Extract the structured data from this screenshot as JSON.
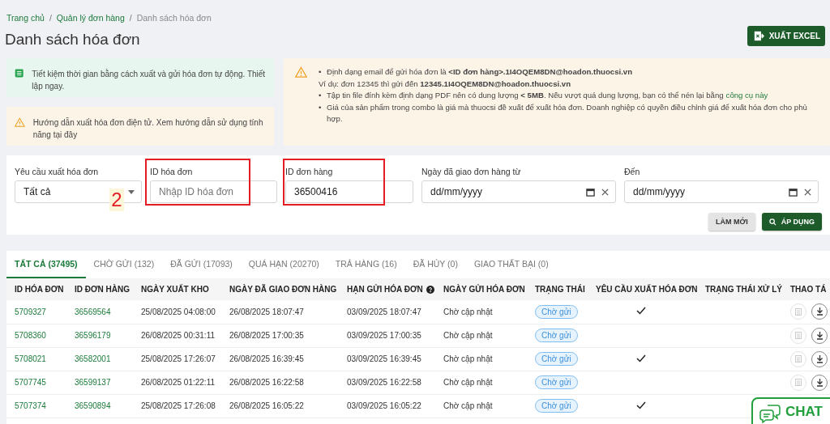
{
  "breadcrumb": [
    {
      "label": "Trang chủ",
      "link": true
    },
    {
      "separator": "/",
      "label": "Quản lý đơn hàng",
      "link": true
    },
    {
      "separator": "/",
      "label": "Danh sách hóa đơn",
      "link": false
    }
  ],
  "title": "Danh sách hóa đơn",
  "export_button": "XUẤT EXCEL",
  "banners": [
    {
      "kind": "tip",
      "text": "Tiết kiệm thời gian bằng cách xuất và gửi hóa đơn tự động. Thiết lập ngay."
    },
    {
      "kind": "warning",
      "text": "Hướng dẫn xuất hóa đơn điện tử. Xem hướng dẫn sử dụng tính năng tại đây"
    }
  ],
  "notice": [
    {
      "marker": "•",
      "text": "Định dạng email để gửi hóa đơn là **<ID đơn hàng>.1I4OQEM8DN@hoadon.thuocsi.vn**"
    },
    {
      "text": "Ví dụ: đơn 12345 thì gửi đến **12345.1I4OQEM8DN@hoadon.thuocsi.vn**"
    },
    {
      "marker": "•",
      "text": "Tập tin file đính kèm định dạng PDF nên có dung lượng **< 5MB**. Nếu vượt quá dung lượng, bạn có thể nén lại bằng",
      "link": "công cụ này"
    },
    {
      "marker": "•",
      "text": "Giá của sản phẩm trong combo là giá mà thuocsi đề xuất để xuất hóa đơn. Doanh nghiệp có quyền điều chỉnh giá để xuất hóa đơn cho phù hợp."
    }
  ],
  "filters": [
    {
      "kind": "select",
      "label": "Yêu cầu xuất hóa đơn",
      "value": "Tất cả",
      "highlighted": false
    },
    {
      "kind": "text",
      "label": "ID hóa đơn",
      "placeholder": "Nhập ID hóa đơn",
      "highlighted": true
    },
    {
      "kind": "text",
      "label": "ID đơn hàng",
      "value": "36500416",
      "highlighted": true
    },
    {
      "kind": "date",
      "label": "Ngày đã giao đơn hàng từ",
      "value": "dd/mm/yyyy",
      "highlighted": false
    },
    {
      "kind": "date",
      "label": "Đến",
      "value": "dd/mm/yyyy",
      "highlighted": false
    }
  ],
  "annotation": "2",
  "buttons": [
    {
      "kind": "secondary",
      "label": "LÀM MỚI"
    },
    {
      "kind": "primary",
      "label": "ÁP DỤNG"
    }
  ],
  "tabs": [
    {
      "label": "TẤT CẢ (37495)",
      "selected": true
    },
    {
      "label": "CHỜ GỬI (132)",
      "selected": false
    },
    {
      "label": "ĐÃ GỬI (17093)",
      "selected": false
    },
    {
      "label": "QUÁ HẠN (20270)",
      "selected": false
    },
    {
      "label": "TRẢ HÀNG (16)",
      "selected": false
    },
    {
      "label": "ĐÃ HỦY (0)",
      "selected": false
    },
    {
      "label": "GIAO THẤT BẠI (0)",
      "selected": false
    }
  ],
  "table": {
    "columns": [
      {
        "label": "ID HÓA ĐƠN"
      },
      {
        "label": "ID ĐƠN HÀNG"
      },
      {
        "label": "NGÀY XUẤT KHO"
      },
      {
        "label": "NGÀY ĐÃ GIAO ĐƠN HÀNG"
      },
      {
        "label": "HẠN GỬI HÓA ĐƠN",
        "help": true
      },
      {
        "label": "NGÀY GỬI HÓA ĐƠN"
      },
      {
        "label": "TRẠNG THÁI"
      },
      {
        "label": "YÊU CẦU XUẤT HÓA ĐƠN"
      },
      {
        "label": "TRẠNG THÁI XỬ LÝ"
      },
      {
        "label": "THAO TÁ"
      }
    ],
    "rows": [
      {
        "invoice_id": "5709327",
        "order_id": "36569564",
        "shipped": "25/08/2025 04:08:00",
        "delivered": "26/08/2025 18:07:47",
        "deadline": "03/09/2025 18:07:47",
        "sent": "Chờ cập nhật",
        "status": "Chờ gửi",
        "export_requested": true,
        "actions_shown": true
      },
      {
        "invoice_id": "5708360",
        "order_id": "36596179",
        "shipped": "26/08/2025 00:31:11",
        "delivered": "26/08/2025 17:00:35",
        "deadline": "03/09/2025 17:00:35",
        "sent": "Chờ cập nhật",
        "status": "Chờ gửi",
        "export_requested": false,
        "actions_shown": true
      },
      {
        "invoice_id": "5708021",
        "order_id": "36582001",
        "shipped": "25/08/2025 17:26:07",
        "delivered": "26/08/2025 16:39:45",
        "deadline": "03/09/2025 16:39:45",
        "sent": "Chờ cập nhật",
        "status": "Chờ gửi",
        "export_requested": true,
        "actions_shown": true
      },
      {
        "invoice_id": "5707745",
        "order_id": "36599137",
        "shipped": "26/08/2025 01:22:11",
        "delivered": "26/08/2025 16:22:58",
        "deadline": "03/09/2025 16:22:58",
        "sent": "Chờ cập nhật",
        "status": "Chờ gửi",
        "export_requested": false,
        "actions_shown": true
      },
      {
        "invoice_id": "5707374",
        "order_id": "36590894",
        "shipped": "25/08/2025 17:26:08",
        "delivered": "26/08/2025 16:05:22",
        "deadline": "03/09/2025 16:05:22",
        "sent": "Chờ cập nhật",
        "status": "Chờ gửi",
        "export_requested": true,
        "actions_shown": false
      }
    ]
  },
  "chat_button": "CHAT"
}
